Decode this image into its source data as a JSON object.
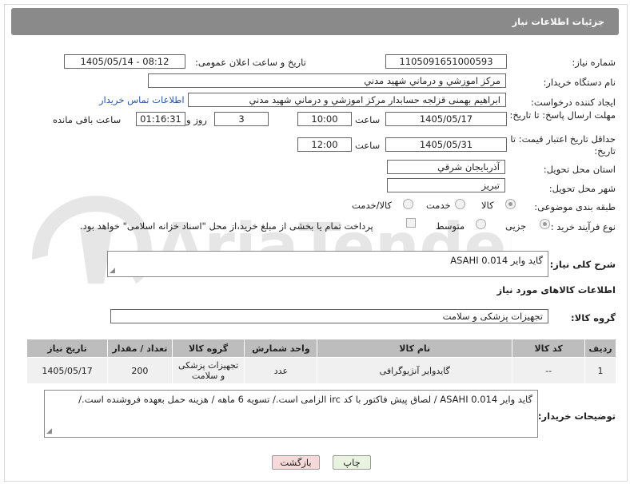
{
  "header": {
    "title": "جزئیات اطلاعات نیاز"
  },
  "fields": {
    "need_number_label": "شماره نیاز:",
    "need_number": "1105091651000593",
    "announce_label": "تاریخ و ساعت اعلان عمومی:",
    "announce_value": "1405/05/14 - 08:12",
    "buyer_org_label": "نام دستگاه خریدار:",
    "buyer_org": "مرکز اموزشي و درماني شهيد مدني",
    "requester_label": "ایجاد کننده درخواست:",
    "requester": "ابراهیم بهمنی قزلجه حسابدار مرکز اموزشي و درماني شهيد مدني",
    "contact_link": "اطلاعات تماس خریدار",
    "reply_deadline_label": "مهلت ارسال پاسخ: تا تاریخ:",
    "reply_date": "1405/05/17",
    "time_label": "ساعت",
    "reply_time": "10:00",
    "days_value": "3",
    "days_label": "روز و",
    "remaining_time": "01:16:31",
    "remaining_label": "ساعت باقی مانده",
    "price_validity_label": "حداقل تاریخ اعتبار قیمت: تا تاریخ:",
    "price_date": "1405/05/31",
    "price_time": "12:00",
    "province_label": "استان محل تحویل:",
    "province": "آذربايجان شرقي",
    "city_label": "شهر محل تحویل:",
    "city": "تبریز",
    "category_label": "طبقه بندی موضوعی:",
    "category_options": [
      "کالا",
      "خدمت",
      "کالا/خدمت"
    ],
    "process_label": "نوع فرآیند خرید :",
    "process_options": [
      "جزیی",
      "متوسط"
    ],
    "payment_note": "پرداخت تمام یا بخشی از مبلغ خرید،از محل \"اسناد خزانه اسلامی\" خواهد بود."
  },
  "summary": {
    "label": "شرح کلی نیاز:",
    "value": "گاید وایر ASAHI 0.014"
  },
  "goods_info_title": "اطلاعات کالاهای مورد نیاز",
  "goods_group": {
    "label": "گروه کالا:",
    "value": "تجهیزات پزشکی و سلامت"
  },
  "table": {
    "headers": [
      "ردیف",
      "کد کالا",
      "نام کالا",
      "واحد شمارش",
      "گروه کالا",
      "تعداد / مقدار",
      "تاریخ نیاز"
    ],
    "rows": [
      [
        "1",
        "--",
        "گایدوایر آنژیوگرافی",
        "عدد",
        "تجهیزات پزشکی و سلامت",
        "200",
        "1405/05/17"
      ]
    ]
  },
  "buyer_notes": {
    "label": "توضیحات خریدار:",
    "value": "گاید وایر ASAHI 0.014 / لصاق پیش فاکتور با کد irc الزامی است./ تسویه 6 ماهه / هزینه حمل بعهده فروشنده است./"
  },
  "buttons": {
    "print": "چاپ",
    "back": "بازگشت"
  },
  "watermark": "AriaTender.neT",
  "colors": {
    "header": "#8a8a8a",
    "link": "#2a57a8",
    "back_btn": "#f7d9d9",
    "print_btn": "#e8f3e0",
    "watermark": "#e6e6e6"
  }
}
